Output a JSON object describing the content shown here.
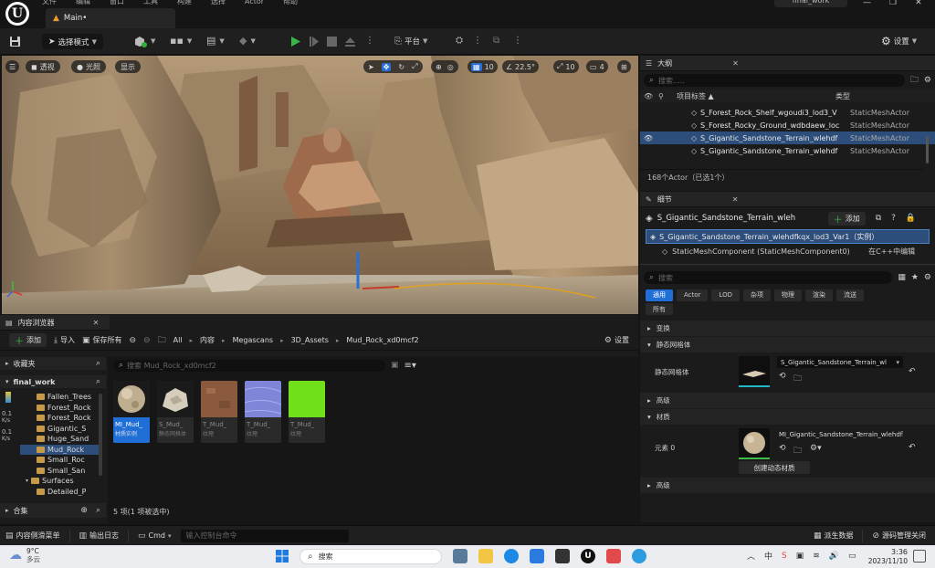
{
  "titlebar": {
    "menu": [
      "文件",
      "编辑",
      "窗口",
      "工具",
      "构建",
      "选择",
      "Actor",
      "帮助"
    ],
    "tab_label": "Main•",
    "project_name": "final_work"
  },
  "toolbar": {
    "select_mode": "选择模式",
    "platform": "平台",
    "settings": "设置"
  },
  "viewport": {
    "perspective": "透视",
    "lighting": "光照",
    "show": "显示",
    "grid_snap": "10",
    "angle_snap": "22.5°",
    "scale_snap": "10",
    "camera_speed": "4"
  },
  "outliner": {
    "tab_title": "大纲",
    "search_placeholder": "搜索.....",
    "col_label": "项目标签 ▲",
    "col_type": "类型",
    "rows": [
      {
        "label": "S_Forest_Rock_Shelf_wgoudi3_lod3_V",
        "type": "StaticMeshActor",
        "selected": false
      },
      {
        "label": "S_Forest_Rocky_Ground_wdbdaew_loc",
        "type": "StaticMeshActor",
        "selected": false
      },
      {
        "label": "S_Gigantic_Sandstone_Terrain_wlehdf",
        "type": "StaticMeshActor",
        "selected": true
      },
      {
        "label": "S_Gigantic_Sandstone_Terrain_wlehdf",
        "type": "StaticMeshActor",
        "selected": false
      }
    ],
    "footer": "168个Actor（已选1个）"
  },
  "details": {
    "tab_title": "细节",
    "actor_name": "S_Gigantic_Sandstone_Terrain_wleh",
    "add_label": "添加",
    "instance_label": "S_Gigantic_Sandstone_Terrain_wlehdfkqx_lod3_Var1（实例）",
    "component_label": "StaticMeshComponent (StaticMeshComponent0)",
    "edit_cpp": "在C++中编辑",
    "search_placeholder": "搜索",
    "filters": [
      "通用",
      "Actor",
      "LOD",
      "杂项",
      "物理",
      "渲染",
      "流送"
    ],
    "filter_all": "所有",
    "sections": {
      "transform": "变换",
      "static_mesh": "静态网格体",
      "static_mesh_prop": "静态网格体",
      "static_mesh_value": "S_Gigantic_Sandstone_Terrain_wl",
      "advanced1": "高级",
      "materials": "材质",
      "element0": "元素 0",
      "material_value": "MI_Gigantic_Sandstone_Terrain_wlehdfl",
      "create_dynamic": "创建动态材质",
      "advanced2": "高级"
    }
  },
  "content_browser": {
    "tab_title": "内容浏览器",
    "add_label": "添加",
    "import_label": "导入",
    "save_all": "保存所有",
    "breadcrumb": [
      "All",
      "内容",
      "Megascans",
      "3D_Assets",
      "Mud_Rock_xd0mcf2"
    ],
    "settings": "设置",
    "favorites": "收藏夹",
    "project": "final_work",
    "tree": [
      {
        "name": "Fallen_Trees",
        "level": 2,
        "selected": false
      },
      {
        "name": "Forest_Rock",
        "level": 2,
        "selected": false
      },
      {
        "name": "Forest_Rock",
        "level": 2,
        "selected": false
      },
      {
        "name": "Gigantic_S",
        "level": 2,
        "selected": false
      },
      {
        "name": "Huge_Sand",
        "level": 2,
        "selected": false
      },
      {
        "name": "Mud_Rock",
        "level": 2,
        "selected": true
      },
      {
        "name": "Small_Roc",
        "level": 2,
        "selected": false
      },
      {
        "name": "Small_San",
        "level": 2,
        "selected": false
      },
      {
        "name": "Surfaces",
        "level": 1,
        "selected": false
      },
      {
        "name": "Detailed_P",
        "level": 2,
        "selected": false
      }
    ],
    "collections": "合集",
    "search_placeholder": "搜索 Mud_Rock_xd0mcf2",
    "assets": [
      {
        "name": "MI_Mud_",
        "type": "材质实例",
        "selected": true,
        "color": "#2a6fd6"
      },
      {
        "name": "S_Mud_",
        "type": "静态网格体",
        "selected": false,
        "color": "#23b8c8"
      },
      {
        "name": "T_Mud_",
        "type": "纹理",
        "selected": false,
        "color": "#b04040"
      },
      {
        "name": "T_Mud_",
        "type": "纹理",
        "selected": false,
        "color": "#b04040"
      },
      {
        "name": "T_Mud_",
        "type": "纹理",
        "selected": false,
        "color": "#b04040"
      }
    ],
    "footer": "5 项(1 项被选中)",
    "side_values": [
      "0.1",
      "K/s",
      "0.1",
      "K/s"
    ]
  },
  "statusbar": {
    "drawer": "内容侧滑菜单",
    "output_log": "输出日志",
    "cmd": "Cmd",
    "console_placeholder": "输入控制台命令",
    "derived_data": "派生数据",
    "source_control": "源码管理关闭"
  },
  "taskbar": {
    "temp": "9°C",
    "weather": "多云",
    "search": "搜索",
    "time": "3:36",
    "date": "2023/11/10",
    "ime": "中"
  }
}
